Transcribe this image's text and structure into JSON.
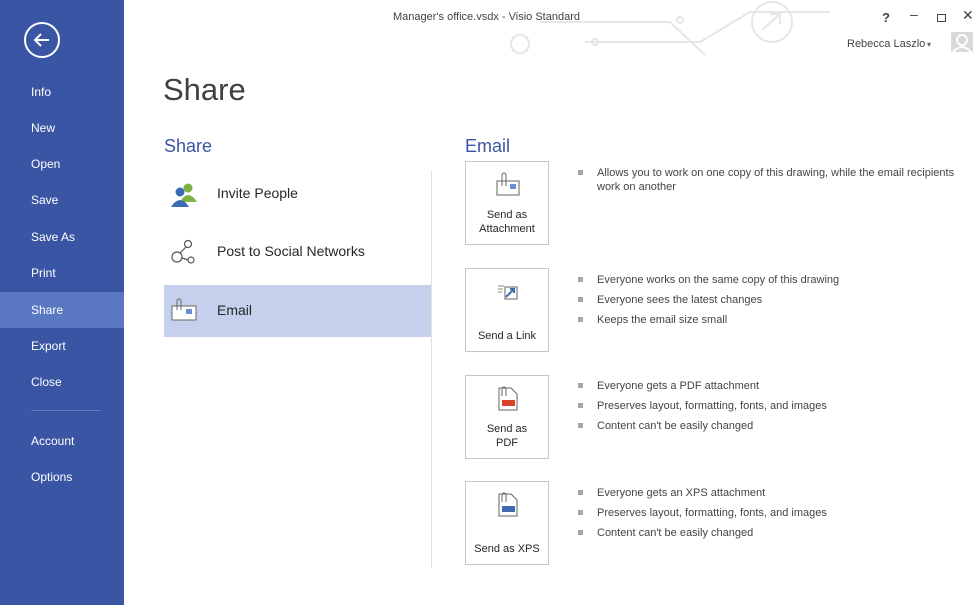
{
  "window": {
    "title": "Manager's office.vsdx - Visio Standard",
    "help": "?",
    "minimize": "–",
    "close": "✕",
    "user_name": "Rebecca Laszlo",
    "user_caret": "▾"
  },
  "sidebar": {
    "items": [
      {
        "label": "Info"
      },
      {
        "label": "New"
      },
      {
        "label": "Open"
      },
      {
        "label": "Save"
      },
      {
        "label": "Save As"
      },
      {
        "label": "Print"
      },
      {
        "label": "Share"
      },
      {
        "label": "Export"
      },
      {
        "label": "Close"
      },
      {
        "label": "Account"
      },
      {
        "label": "Options"
      }
    ],
    "active": "Share"
  },
  "page": {
    "title": "Share",
    "share_heading": "Share",
    "email_heading": "Email"
  },
  "share_options": [
    {
      "label": "Invite People",
      "icon": "people-icon"
    },
    {
      "label": "Post to Social Networks",
      "icon": "social-network-icon"
    },
    {
      "label": "Email",
      "icon": "email-icon",
      "selected": true
    }
  ],
  "email_actions": [
    {
      "label_line1": "Send as",
      "label_line2": "Attachment",
      "icon": "attachment-icon",
      "bullets": [
        "Allows you to work on one copy of this drawing, while the email recipients work on another"
      ]
    },
    {
      "label_line1": "Send a Link",
      "label_line2": "",
      "icon": "link-icon",
      "bullets": [
        "Everyone works on the same copy of this drawing",
        "Everyone sees the latest changes",
        "Keeps the email size small"
      ]
    },
    {
      "label_line1": "Send as",
      "label_line2": "PDF",
      "icon": "pdf-icon",
      "bullets": [
        "Everyone gets a PDF attachment",
        "Preserves layout, formatting, fonts, and images",
        "Content can't be easily changed"
      ]
    },
    {
      "label_line1": "Send as XPS",
      "label_line2": "",
      "icon": "xps-icon",
      "bullets": [
        "Everyone gets an XPS attachment",
        "Preserves layout, formatting, fonts, and images",
        "Content can't be easily changed"
      ]
    }
  ],
  "colors": {
    "sidebar": "#3955a3",
    "sidebar_active": "#5a77c2",
    "accent": "#3955a3",
    "selected_row": "#c5d0ed"
  }
}
